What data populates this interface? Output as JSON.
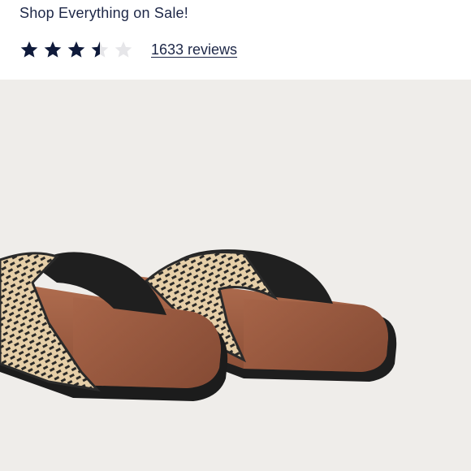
{
  "promo": {
    "text": "Shop Everything on Sale!"
  },
  "rating": {
    "value": 3.5,
    "max": 5,
    "filled_color": "#0f1a3a",
    "empty_color": "#e6e6e9",
    "reviews_text": "1633 reviews"
  },
  "product_image": {
    "icon": "woven-slide-sandals",
    "colors": {
      "background": "#efedea",
      "footbed": "#9e5f44",
      "sole": "#1c1c1c",
      "strap_light": "#e6cfa8",
      "strap_dark": "#2a2a2a"
    }
  }
}
